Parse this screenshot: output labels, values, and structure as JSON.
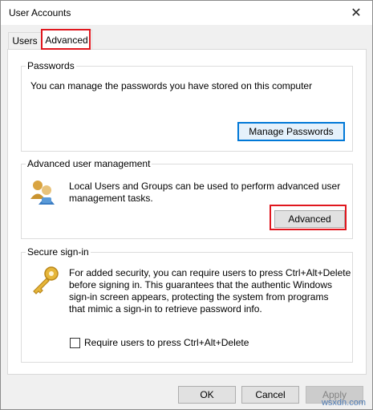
{
  "window": {
    "title": "User Accounts"
  },
  "tabs": [
    {
      "label": "Users"
    },
    {
      "label": "Advanced"
    }
  ],
  "passwords": {
    "label": "Passwords",
    "text": "You can manage the passwords you have stored on this computer",
    "button": "Manage Passwords"
  },
  "advanced_mgmt": {
    "label": "Advanced user management",
    "text_line1": "Local Users and Groups can be used to perform advanced user",
    "text_line2": "management tasks.",
    "button": "Advanced"
  },
  "secure": {
    "label": "Secure sign-in",
    "lines": [
      "For added security, you can require users to press Ctrl+Alt+Delete",
      "before signing in. This guarantees that the authentic Windows",
      "sign-in screen appears, protecting the system from programs",
      "that mimic a sign-in to retrieve password info."
    ],
    "checkbox_label": "Require users to press Ctrl+Alt+Delete"
  },
  "footer": {
    "ok": "OK",
    "cancel": "Cancel",
    "apply": "Apply"
  },
  "watermark": "wsxdn.com",
  "colors": {
    "highlight": "#e0171e",
    "focus": "#0078d7"
  }
}
